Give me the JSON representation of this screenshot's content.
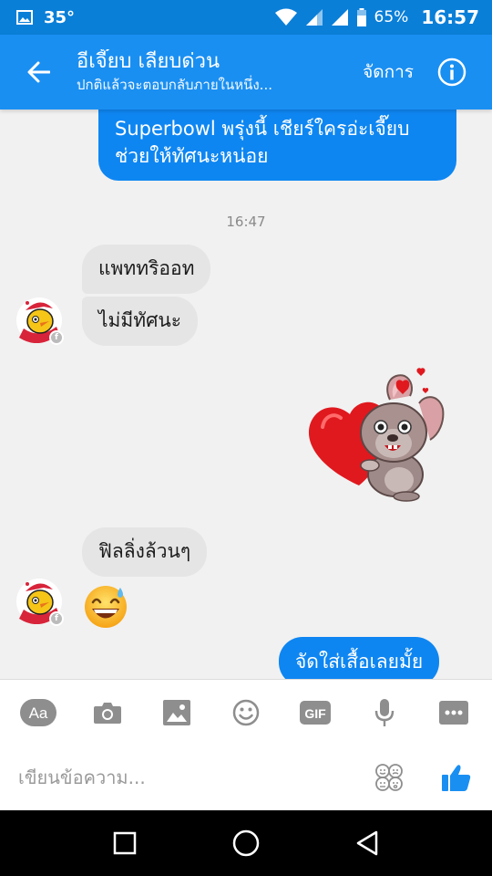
{
  "status_bar": {
    "temperature": "35°",
    "battery_percent": "65%",
    "time": "16:57"
  },
  "header": {
    "title": "อีเจี๊ยบ เลียบด่วน",
    "subtitle": "ปกติแล้วจะตอบกลับภายในหนึ่ง...",
    "manage_label": "จัดการ"
  },
  "messages": {
    "outgoing_1_line1": "Superbowl พรุ่งนี้ เชียร์ใครอ่ะเจี๊ยบ",
    "outgoing_1_line2": "ช่วยให้ทัศนะหน่อย",
    "timestamp": "16:47",
    "incoming_1": "แพททริออท",
    "incoming_2": "ไม่มีทัศนะ",
    "incoming_3": "ฟิลลิ่งล้วนๆ",
    "outgoing_2": "จัดใส่เสื้อเลยมั้ย"
  },
  "composer": {
    "placeholder": "เขียนข้อความ..."
  },
  "icons": {
    "back": "arrow-left-icon",
    "info": "info-icon",
    "text": "aa-icon",
    "camera": "camera-icon",
    "gallery": "image-icon",
    "emoji": "smiley-icon",
    "gif": "gif-icon",
    "mic": "microphone-icon",
    "more": "more-icon",
    "stickers": "sticker-faces-icon",
    "like": "thumbs-up-icon"
  },
  "colors": {
    "accent": "#1a8ff2",
    "outgoing_bubble": "#0e86f2",
    "incoming_bubble": "#e5e5e5"
  }
}
